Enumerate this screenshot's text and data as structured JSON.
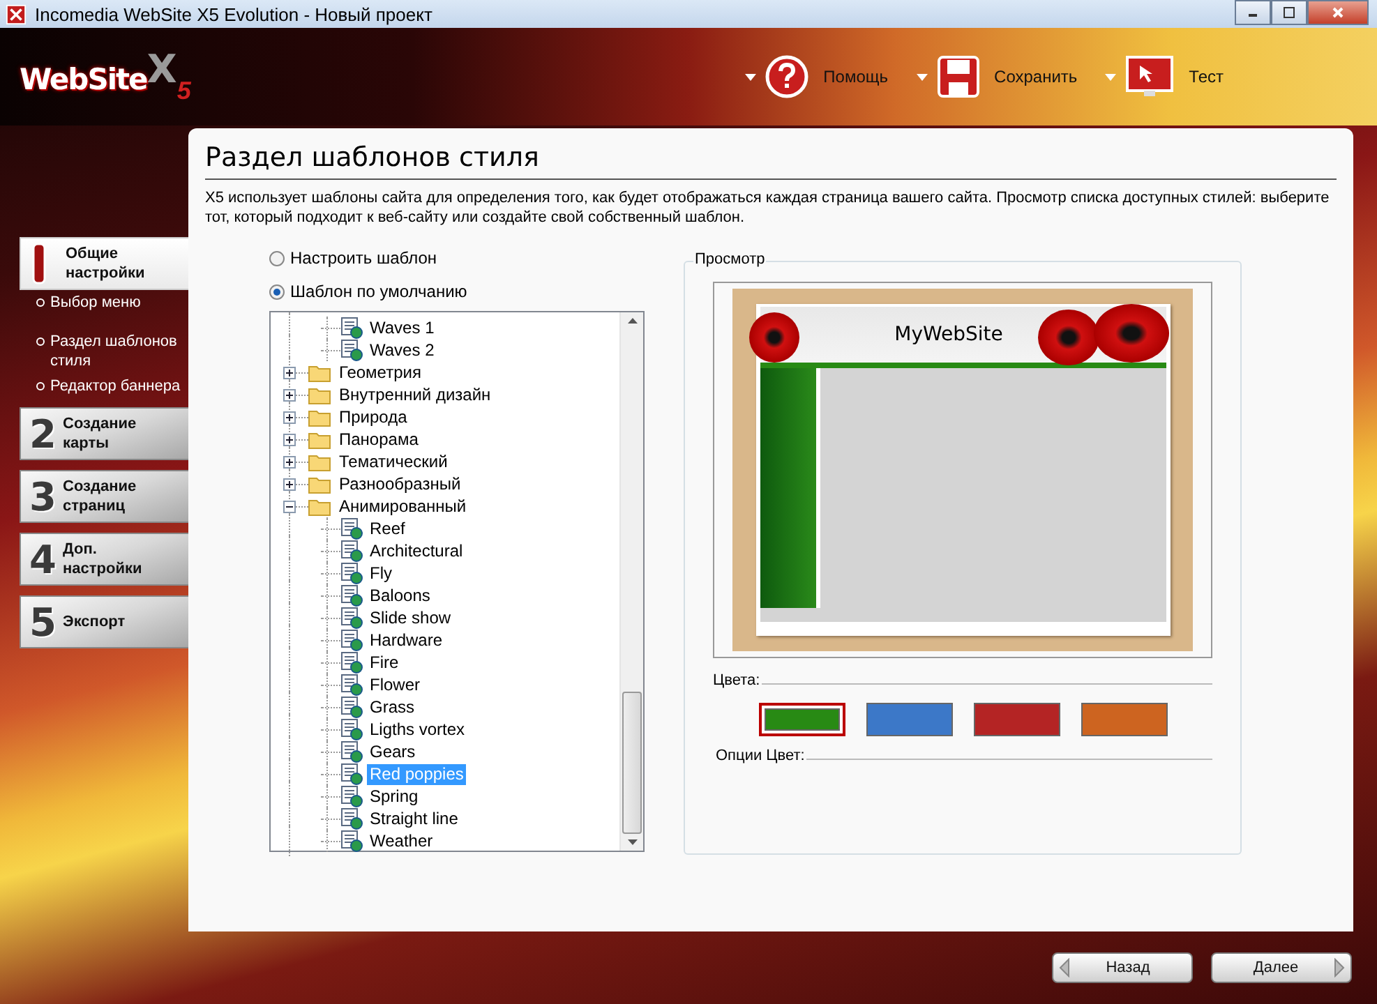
{
  "window": {
    "title": "Incomedia WebSite X5 Evolution - Новый проект"
  },
  "logo": {
    "word": "WebSite",
    "mark": "X",
    "version": "5"
  },
  "toolbar": [
    {
      "kind": "help",
      "label": "Помощь"
    },
    {
      "kind": "save",
      "label": "Сохранить"
    },
    {
      "kind": "test",
      "label": "Тест"
    }
  ],
  "steps": [
    {
      "label": "Общие настройки",
      "selected": true,
      "substeps": [
        "Выбор меню",
        "Раздел шаблонов стиля",
        "Редактор баннера"
      ]
    },
    {
      "number": "2",
      "label": "Создание карты",
      "selected": false
    },
    {
      "number": "3",
      "label": "Создание страниц",
      "selected": false
    },
    {
      "number": "4",
      "label": "Доп. настройки",
      "selected": false
    },
    {
      "number": "5",
      "label": "Экспорт",
      "selected": false
    }
  ],
  "page": {
    "title": "Раздел шаблонов стиля",
    "description": "X5 использует шаблоны сайта для определения того, как будет отображаться каждая страница вашего сайта. Просмотр списка доступных стилей: выберите тот, который подходит к веб-сайту или создайте свой собственный шаблон."
  },
  "options": [
    {
      "label": "Настроить шаблон",
      "selected": false
    },
    {
      "label": "Шаблон по умолчанию",
      "selected": true
    }
  ],
  "tree": [
    {
      "kind": "partial",
      "children": [
        {
          "label": "Waves 1",
          "selected": false
        },
        {
          "label": "Waves 2",
          "selected": false
        }
      ]
    },
    {
      "kind": "folder",
      "label": "Геометрия",
      "expanded": false
    },
    {
      "kind": "folder",
      "label": "Внутренний дизайн",
      "expanded": false
    },
    {
      "kind": "folder",
      "label": "Природа",
      "expanded": false
    },
    {
      "kind": "folder",
      "label": "Панорама",
      "expanded": false
    },
    {
      "kind": "folder",
      "label": "Тематический",
      "expanded": false
    },
    {
      "kind": "folder",
      "label": "Разнообразный",
      "expanded": false
    },
    {
      "kind": "folder",
      "label": "Анимированный",
      "expanded": true,
      "children": [
        {
          "label": "Reef",
          "selected": false
        },
        {
          "label": "Architectural",
          "selected": false
        },
        {
          "label": "Fly",
          "selected": false
        },
        {
          "label": "Baloons",
          "selected": false
        },
        {
          "label": "Slide show",
          "selected": false
        },
        {
          "label": "Hardware",
          "selected": false
        },
        {
          "label": "Fire",
          "selected": false
        },
        {
          "label": "Flower",
          "selected": false
        },
        {
          "label": "Grass",
          "selected": false
        },
        {
          "label": "Ligths vortex",
          "selected": false
        },
        {
          "label": "Gears",
          "selected": false
        },
        {
          "label": "Red poppies",
          "selected": true
        },
        {
          "label": "Spring",
          "selected": false
        },
        {
          "label": "Straight line",
          "selected": false
        },
        {
          "label": "Weather",
          "selected": false
        }
      ]
    }
  ],
  "preview": {
    "legend": "Просмотр",
    "site_title": "MyWebSite",
    "colors_label": "Цвета:",
    "options_label": "Опции Цвет:"
  },
  "colors": [
    {
      "color": "#288a14",
      "selected": true
    },
    {
      "color": "#3c78c8",
      "selected": false
    },
    {
      "color": "#b42424",
      "selected": false
    },
    {
      "color": "#cd6420",
      "selected": false
    }
  ],
  "buttons": [
    {
      "kind": "back",
      "label": "Назад"
    },
    {
      "kind": "next",
      "label": "Далее"
    }
  ]
}
